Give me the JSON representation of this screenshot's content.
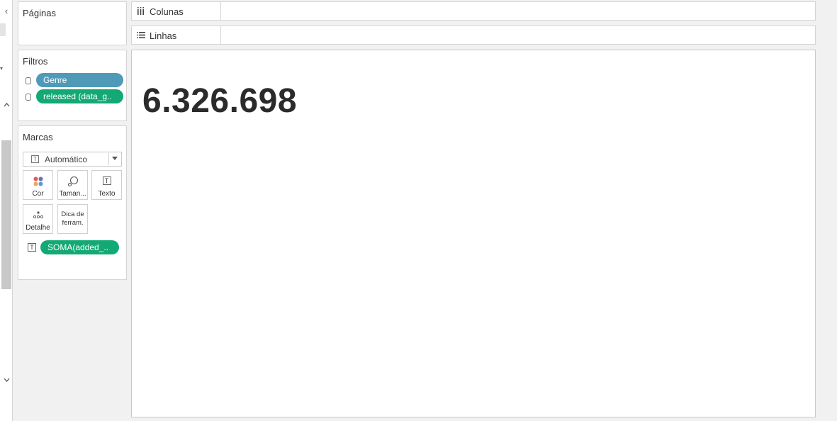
{
  "left_strip": {
    "collapse_glyph": "‹",
    "caret_glyph": "▾",
    "scroll_up_glyph": "^",
    "scroll_down_glyph": "v"
  },
  "pages": {
    "title": "Páginas"
  },
  "filters": {
    "title": "Filtros",
    "items": [
      {
        "label": "Genre",
        "color": "#4f9bb7"
      },
      {
        "label": "released (data_g..",
        "color": "#13a974"
      }
    ]
  },
  "marks": {
    "title": "Marcas",
    "type_dropdown": {
      "value": "Automático",
      "icon": "text-icon"
    },
    "buttons": [
      {
        "label": "Cor",
        "icon": "color-dots-icon"
      },
      {
        "label": "Taman...",
        "icon": "size-icon"
      },
      {
        "label": "Texto",
        "icon": "text-icon"
      },
      {
        "label": "Detalhe",
        "icon": "detail-icon"
      },
      {
        "label_line1": "Dica de",
        "label_line2": "ferram.",
        "icon": "none"
      }
    ],
    "fields": [
      {
        "label": "SOMA(added_..",
        "icon": "text-icon",
        "color": "#13a974"
      }
    ]
  },
  "shelves": {
    "columns": {
      "label": "Colunas",
      "icon": "columns-icon",
      "glyph": "iii"
    },
    "rows": {
      "label": "Linhas",
      "icon": "rows-icon",
      "glyph": "☰"
    }
  },
  "view": {
    "value": "6.326.698"
  }
}
